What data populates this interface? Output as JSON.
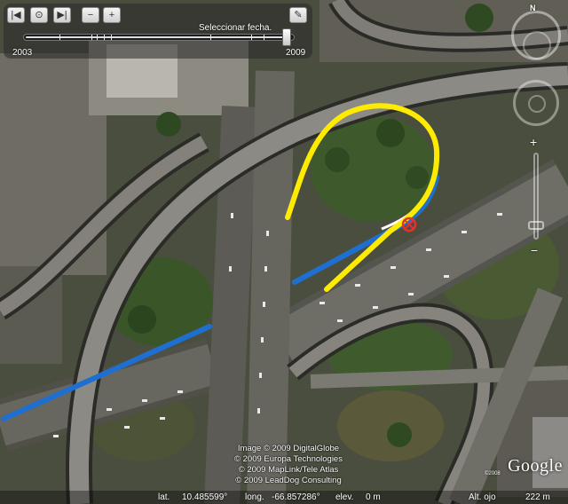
{
  "timeline": {
    "label": "Seleccionar fecha.",
    "start_year": "2003",
    "end_year": "2009",
    "position": 0.98
  },
  "toolbar": {
    "first_icon": "skip-first-icon",
    "play_icon": "timelapse-icon",
    "last_icon": "skip-last-icon",
    "zoom_out_icon": "zoom-out-icon",
    "zoom_in_icon": "zoom-in-icon",
    "settings_icon": "wrench-icon"
  },
  "nav": {
    "north_label": "N",
    "zoom_plus": "+",
    "zoom_minus": "−",
    "zoom_level": 0.9
  },
  "map": {
    "overlay_colors": {
      "yellow_route": "#ffeb00",
      "blue_route": "#1f6fd0",
      "marker": "#e53030"
    }
  },
  "attribution": {
    "line1": "Image © 2009 DigitalGlobe",
    "line2": "© 2009 Europa Technologies",
    "line3": "© 2009 MapLink/Tele Atlas",
    "line4": "© 2009 LeadDog Consulting"
  },
  "logo": {
    "text": "Google",
    "year": "©2008"
  },
  "status": {
    "lat_label": "lat.",
    "lat_value": "10.485599°",
    "lon_label": "long.",
    "lon_value": "-66.857286°",
    "elev_label": "elev.",
    "elev_value": "0 m",
    "eye_label": "Alt. ojo",
    "eye_value": "222 m"
  }
}
